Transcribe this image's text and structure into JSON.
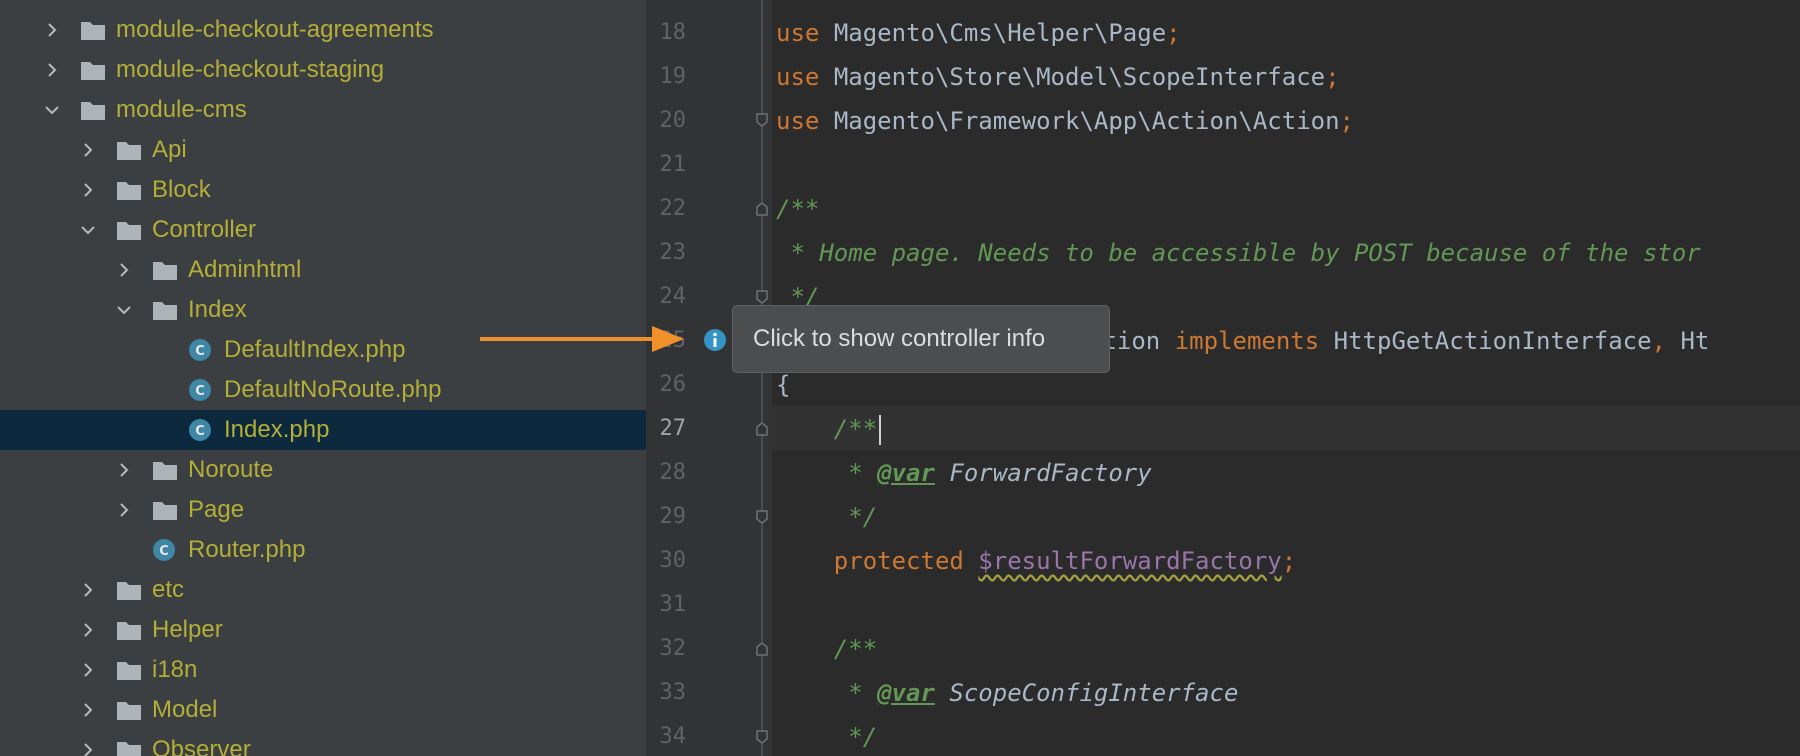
{
  "project_tree": {
    "items": [
      {
        "label": "module-checkout-agreements",
        "type": "folder",
        "expanded": false
      },
      {
        "label": "module-checkout-staging",
        "type": "folder",
        "expanded": false
      },
      {
        "label": "module-cms",
        "type": "folder",
        "expanded": true
      },
      {
        "label": "Api",
        "type": "folder",
        "expanded": false
      },
      {
        "label": "Block",
        "type": "folder",
        "expanded": false
      },
      {
        "label": "Controller",
        "type": "folder",
        "expanded": true
      },
      {
        "label": "Adminhtml",
        "type": "folder",
        "expanded": false
      },
      {
        "label": "Index",
        "type": "folder",
        "expanded": true
      },
      {
        "label": "DefaultIndex.php",
        "type": "class-file"
      },
      {
        "label": "DefaultNoRoute.php",
        "type": "class-file"
      },
      {
        "label": "Index.php",
        "type": "class-file",
        "selected": true
      },
      {
        "label": "Noroute",
        "type": "folder",
        "expanded": false
      },
      {
        "label": "Page",
        "type": "folder",
        "expanded": false
      },
      {
        "label": "Router.php",
        "type": "class-file"
      },
      {
        "label": "etc",
        "type": "folder",
        "expanded": false
      },
      {
        "label": "Helper",
        "type": "folder",
        "expanded": false
      },
      {
        "label": "i18n",
        "type": "folder",
        "expanded": false
      },
      {
        "label": "Model",
        "type": "folder",
        "expanded": false
      },
      {
        "label": "Observer",
        "type": "folder",
        "expanded": false
      }
    ]
  },
  "editor": {
    "current_line": "27",
    "line_numbers": [
      "18",
      "19",
      "20",
      "21",
      "22",
      "23",
      "24",
      "25",
      "26",
      "27",
      "28",
      "29",
      "30",
      "31",
      "32",
      "33",
      "34"
    ],
    "code": {
      "l18_use": "use",
      "l18_ns": "Magento\\Cms\\Helper\\Page",
      "l19_use": "use",
      "l19_ns": "Magento\\Store\\Model\\ScopeInterface",
      "l20_use": "use",
      "l20_ns": "Magento\\Framework\\App\\Action\\Action",
      "semicolon": ";",
      "l22": "/**",
      "l23": " * Home page. Needs to be accessible by POST because of the stor",
      "l24": " */",
      "l25_a": "ction",
      "l25_implements": "implements",
      "l25_iface": "HttpGetActionInterface",
      "l25_comma": ",",
      "l25_tail": "Ht",
      "l26": "{",
      "l27": "    /**",
      "l28_star": "     * ",
      "l28_tag": "@var",
      "l28_type": "ForwardFactory",
      "l29": "     */",
      "l30_indent": "    ",
      "l30_kw": "protected",
      "l30_var": "$resultForwardFactory",
      "l32": "    /**",
      "l33_star": "     * ",
      "l33_tag": "@var",
      "l33_type": "ScopeConfigInterface",
      "l34": "     */"
    }
  },
  "tooltip": {
    "text": "Click to show controller info"
  },
  "colors": {
    "tree_bg": "#3c3f41",
    "selected_row": "#0d293e",
    "folder_label": "#b2ae38",
    "editor_bg": "#2b2b2b",
    "keyword": "#cc7832",
    "comment": "#629755",
    "callout_arrow": "#f0902a",
    "info_icon": "#3592c4"
  },
  "icons": {
    "folder": "folder-icon",
    "class_file": "php-class-icon",
    "info": "info-icon",
    "expand": "chevron-right-icon",
    "collapse": "chevron-down-icon"
  }
}
